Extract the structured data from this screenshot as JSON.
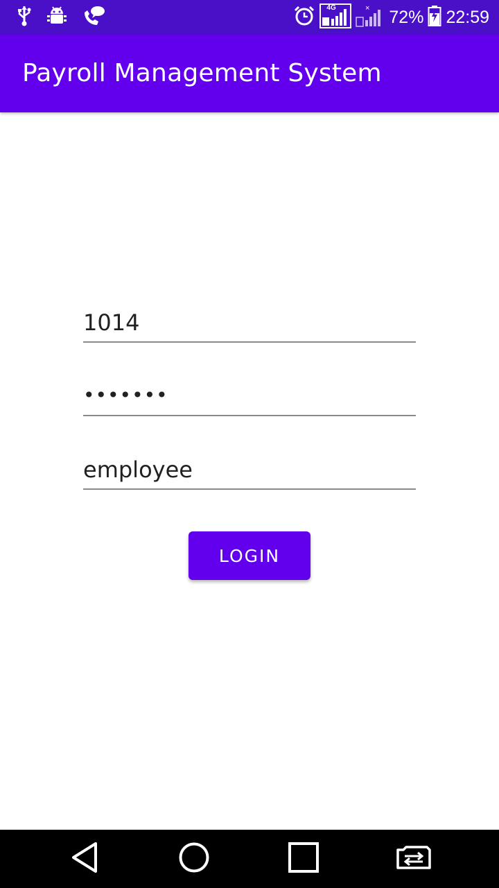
{
  "status_bar": {
    "left_icons": [
      "usb-icon",
      "android-debug-icon",
      "call-message-icon"
    ],
    "right_icons": [
      "alarm-icon",
      "signal-4g-sim1-icon",
      "signal-sim2-icon",
      "battery-charging-icon"
    ],
    "network_label": "4G",
    "battery_percent": "72%",
    "time": "22:59"
  },
  "app_bar": {
    "title": "Payroll Management System"
  },
  "form": {
    "employee_id": "1014",
    "password_masked": "•••••••",
    "role": "employee",
    "login_label": "LOGIN"
  },
  "nav_bar": {
    "icons": [
      "back-icon",
      "home-icon",
      "recents-icon",
      "switch-sim-icon"
    ]
  },
  "colors": {
    "status_bar": "#4a10c8",
    "primary": "#6200ee",
    "text": "#212121",
    "underline": "#8a8a8a",
    "nav_bar": "#000000"
  }
}
